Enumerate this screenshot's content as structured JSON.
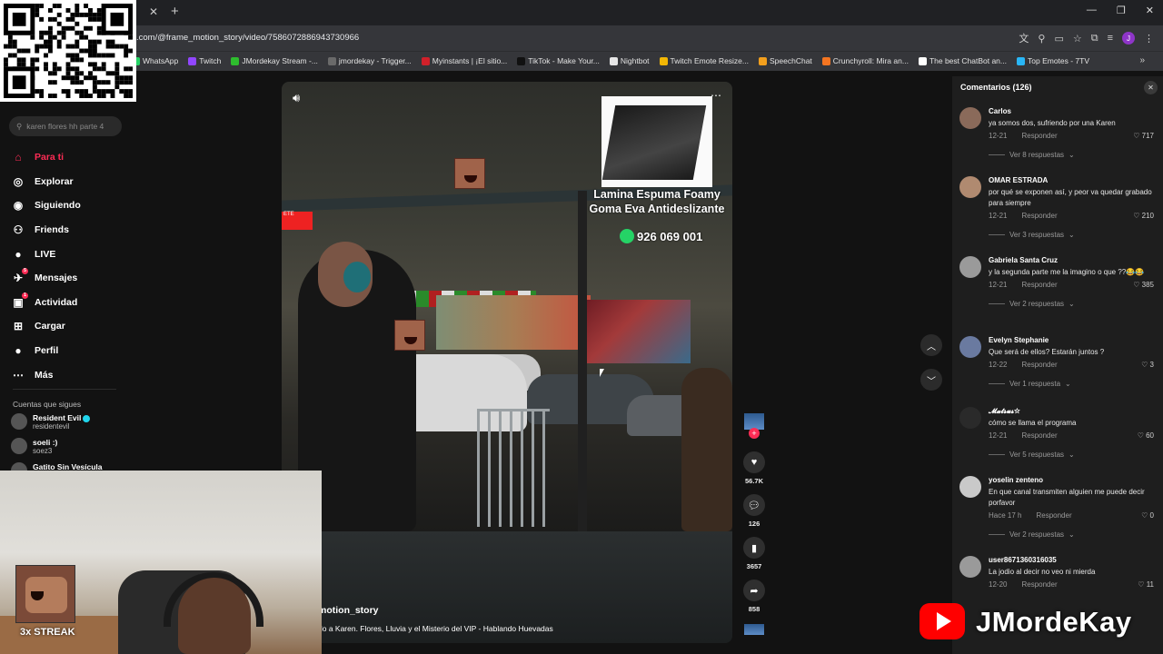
{
  "browser": {
    "url": ".com/@frame_motion_story/video/7586072886943730966",
    "bookmarks": [
      {
        "label": "WhatsApp",
        "color": "#25d366"
      },
      {
        "label": "Twitch",
        "color": "#9146ff"
      },
      {
        "label": "JMordekay Stream -...",
        "color": "#2ebd2e"
      },
      {
        "label": "jmordekay - Trigger...",
        "color": "#6a6a6a"
      },
      {
        "label": "Myinstants | ¡El sitio...",
        "color": "#d0202a"
      },
      {
        "label": "TikTok - Make Your...",
        "color": "#111111"
      },
      {
        "label": "Nightbot",
        "color": "#e6e6e6"
      },
      {
        "label": "Twitch Emote Resize...",
        "color": "#f2b705"
      },
      {
        "label": "SpeechChat",
        "color": "#f29f1d"
      },
      {
        "label": "Crunchyroll: Mira an...",
        "color": "#f47521"
      },
      {
        "label": "The best ChatBot an...",
        "color": "#ffffff"
      },
      {
        "label": "Top Emotes - 7TV",
        "color": "#29b6f6"
      }
    ]
  },
  "sidebar": {
    "search_placeholder": "karen flores hh parte 4",
    "nav": [
      {
        "label": "Para ti",
        "icon": "home-icon",
        "active": true
      },
      {
        "label": "Explorar",
        "icon": "compass-icon"
      },
      {
        "label": "Siguiendo",
        "icon": "following-icon"
      },
      {
        "label": "Friends",
        "icon": "friends-icon"
      },
      {
        "label": "LIVE",
        "icon": "live-icon"
      },
      {
        "label": "Mensajes",
        "icon": "messages-icon",
        "badge": "5"
      },
      {
        "label": "Actividad",
        "icon": "activity-icon",
        "badge": "1"
      },
      {
        "label": "Cargar",
        "icon": "upload-icon"
      },
      {
        "label": "Perfil",
        "icon": "profile-icon"
      },
      {
        "label": "Más",
        "icon": "more-icon"
      }
    ],
    "following_title": "Cuentas que sigues",
    "following": [
      {
        "name": "Resident Evil",
        "user": "residentevil",
        "verified": true
      },
      {
        "name": "soeli :)",
        "user": "soez3"
      },
      {
        "name": "Gatito Sin Vesícula",
        "user": ""
      }
    ]
  },
  "overlay": {
    "streak": "3x STREAK",
    "brand": "JMordeKay"
  },
  "video": {
    "ad_text": "Lamina Espuma Foamy Goma Eva Antideslizante",
    "ad_phone": "926 069 001",
    "username": "motion_story",
    "description": "do a Karen. Flores, Lluvia y el Misterio del VIP - Hablando Huevadas",
    "mini_label": "ETE"
  },
  "actions": {
    "likes": "56.7K",
    "comments": "126",
    "saves": "3657",
    "shares": "858"
  },
  "comments": {
    "title": "Comentarios (126)",
    "reply_label": "Responder",
    "items": [
      {
        "user": "Carlos",
        "text": "ya somos dos, sufriendo por una Karen",
        "date": "12-21",
        "likes": "717",
        "replies": "Ver 8 respuestas"
      },
      {
        "user": "OMAR ESTRADA",
        "text": "por qué se exponen así, y peor va quedar grabado para siempre",
        "date": "12-21",
        "likes": "210",
        "replies": "Ver 3 respuestas"
      },
      {
        "user": "Gabriela Santa Cruz",
        "text": "y la segunda parte me la imagino o que ??😂😂",
        "date": "12-21",
        "likes": "385",
        "replies": "Ver 2 respuestas"
      },
      {
        "user": "Evelyn Stephanie",
        "text": "Que será de ellos? Estarán juntos ?",
        "date": "12-22",
        "likes": "3",
        "replies": "Ver 1 respuesta"
      },
      {
        "user": "𝓜𝓪𝓽𝓼𝓾𝓼✩",
        "text": "cómo se llama el programa",
        "date": "12-21",
        "likes": "60",
        "replies": "Ver 5 respuestas"
      },
      {
        "user": "yoselin zenteno",
        "text": "En que canal transmiten alguien me puede decir porfavor",
        "date": "Hace 17 h",
        "likes": "0",
        "replies": "Ver 2 respuestas"
      },
      {
        "user": "user8671360316035",
        "text": "La jodio al decir no veo ni mierda",
        "date": "12-20",
        "likes": "11",
        "replies": ""
      }
    ]
  }
}
